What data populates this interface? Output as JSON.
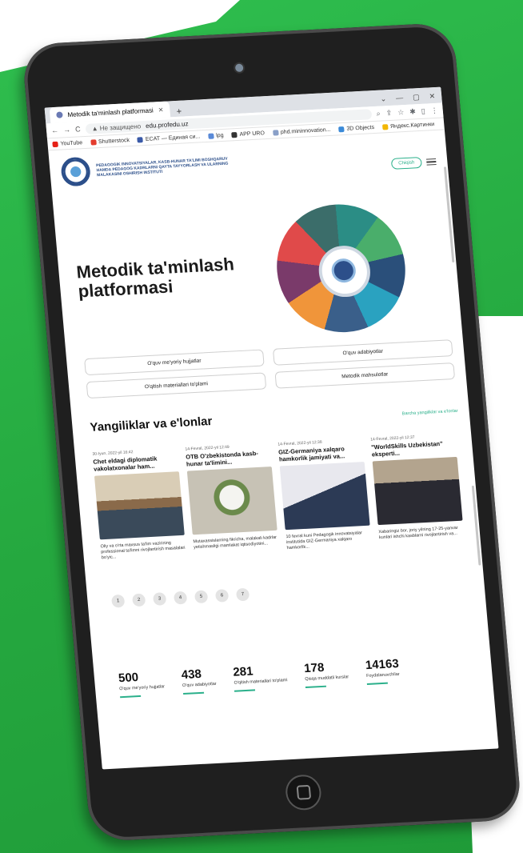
{
  "colors": {
    "background": "#25a83f",
    "accent": "#2bb08b",
    "tablet": "#1f1f1f"
  },
  "browser": {
    "tab_title": "Metodik ta'minlash platformasi",
    "new_tab": "+",
    "window_controls": [
      "⌄",
      "—",
      "▢",
      "✕"
    ],
    "back": "←",
    "forward": "→",
    "reload": "C",
    "security": "▲ Не защищено",
    "url": "edu.profedu.uz",
    "bookmarks": [
      "YouTube",
      "Shutterstock",
      "ECAT — Единая си...",
      "lpg",
      "APP URO",
      "phd.mininnovation...",
      "3D Objects",
      "Яндекс.Картинки"
    ]
  },
  "header": {
    "institute": "PEDAGOGIK INNOVATSIYALAR, KASB-HUNAR TA'LIMI BOSHQARUV HAMDA PEDAGOG KADRLARNI QAYTA TAYYORLASH VA ULARNING MALAKASINI OSHIRISH INSTITUTI",
    "logout": "Chiqish"
  },
  "hero": {
    "title": "Metodik ta'minlash platformasi"
  },
  "categories": [
    "O'quv me'yoriy hujjatlar",
    "O'quv adabiyotlar",
    "O'qitish materiallari to'plami",
    "Metodik mahsulotlar"
  ],
  "news": {
    "title": "Yangiliklar va e'lonlar",
    "all_link": "Barcha yangiliklar va e'lonlar",
    "items": [
      {
        "date": "30-Iyun, 2022-yil 16:42",
        "title": "Chet eldagi diplomatik vakolatxonalar ham...",
        "text": "Oliy va o'rta maxsus ta'lim vazirining professional ta'limni rivojlantirish masalalari bo'yic..."
      },
      {
        "date": "14-Fevral, 2022-yil 12:49",
        "title": "OTB O'zbekistonda kasb-hunar ta'limini...",
        "text": "Mutaxassislarning fikricha, malakali kadrlar yetishmasligi mamlakat iqtisodiyotini..."
      },
      {
        "date": "14-Fevral, 2022-yil 12:38",
        "title": "GIZ-Germaniya xalqaro hamkorlik jamiyati va...",
        "text": "10 fevral kuni Pedagogik innovatsiyalar institutida GIZ-Germaniya xalqaro hamkorlik..."
      },
      {
        "date": "14-Fevral, 2022-yil 12:37",
        "title": "\"WorldSkills Uzbekistan\" eksperti...",
        "text": "Xabaringiz bor, joriy yilning 17-25-yanvar kunlari ishchi kasblarni rivojlantirish va..."
      }
    ]
  },
  "pagination": [
    "1",
    "2",
    "3",
    "4",
    "5",
    "6",
    "7"
  ],
  "stats": [
    {
      "value": "500",
      "label": "O'quv me'yoriy hujjatlar"
    },
    {
      "value": "438",
      "label": "O'quv adabiyotlar"
    },
    {
      "value": "281",
      "label": "O'qitish materiallari to'plami"
    },
    {
      "value": "178",
      "label": "Qisqa muddatli kurslar"
    },
    {
      "value": "14163",
      "label": "Foydalanuvchilar"
    }
  ]
}
